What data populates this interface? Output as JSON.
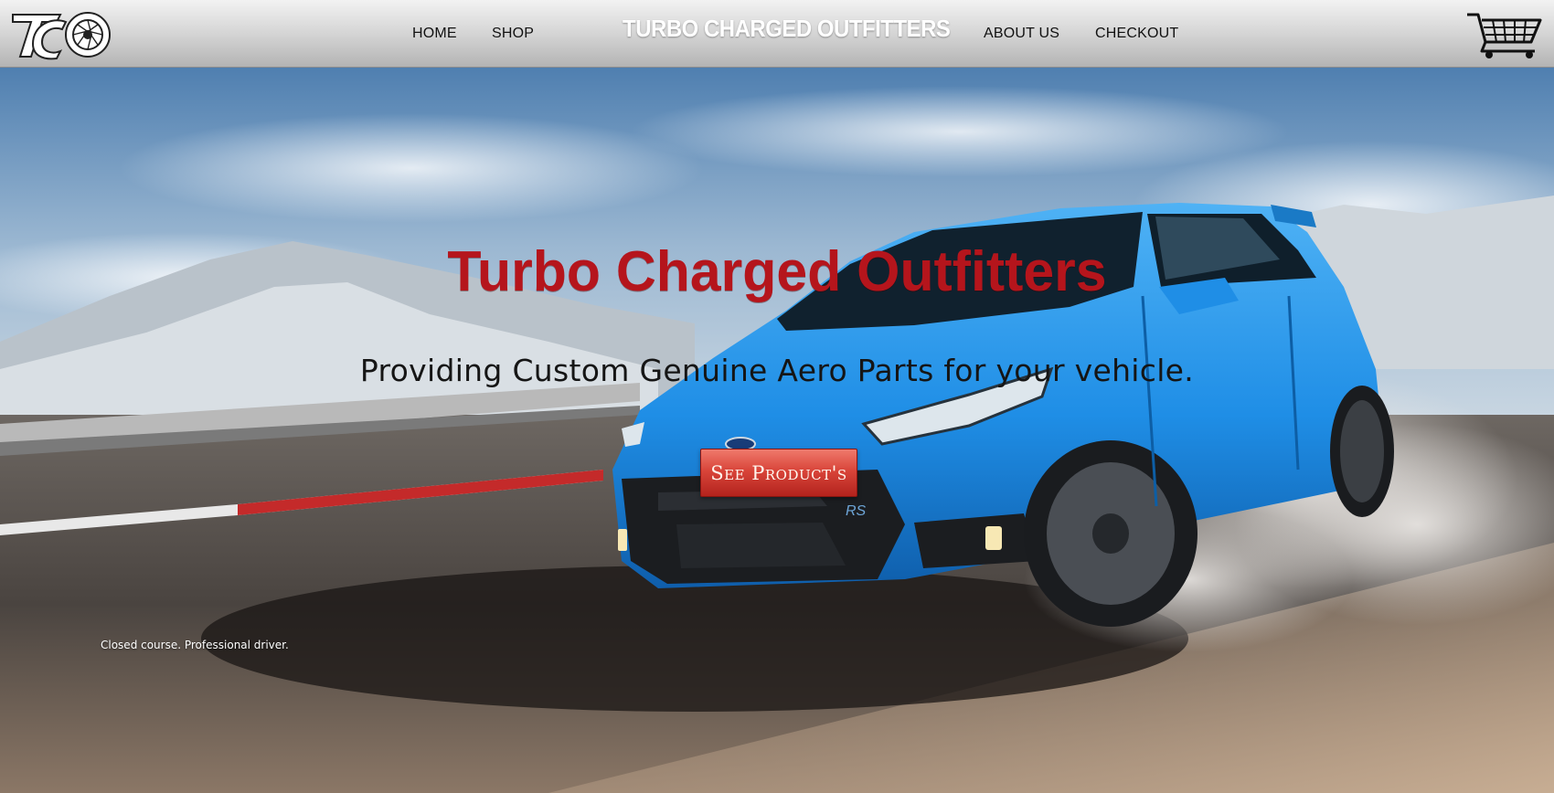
{
  "nav": {
    "logo_text": "TCO",
    "home": "HOME",
    "shop": "SHOP",
    "brand": "TURBO CHARGED OUTFITTERS",
    "about": "ABOUT US",
    "checkout": "CHECKOUT",
    "cart_icon": "shopping-cart-icon"
  },
  "hero": {
    "title": "Turbo Charged Outfitters",
    "subtitle": "Providing Custom Genuine Aero Parts for your vehicle.",
    "cta_label": "See Product's",
    "disclaimer": "Closed course. Professional driver.",
    "car_badge": "RS"
  },
  "colors": {
    "accent_red": "#b5151c",
    "cta_red": "#d9453a",
    "car_blue": "#1f8ee6",
    "nav_gray": "#d0d0d0"
  }
}
